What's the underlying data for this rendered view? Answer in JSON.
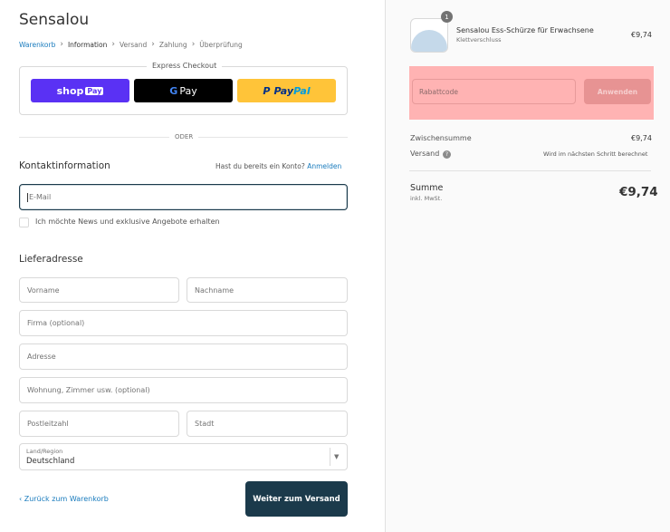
{
  "store": {
    "title": "Sensalou"
  },
  "breadcrumb": {
    "items": [
      "Warenkorb",
      "Information",
      "Versand",
      "Zahlung",
      "Überprüfung"
    ],
    "separator": "›"
  },
  "express_checkout": {
    "label": "Express Checkout",
    "buttons": {
      "shop_pay": {
        "text": "shop",
        "badge": "Pay"
      },
      "google_pay": {
        "g": "G",
        "text": "Pay"
      },
      "paypal": {
        "part1": "Pay",
        "part2": "Pal",
        "mark": "P"
      }
    },
    "divider": "ODER"
  },
  "contact": {
    "title": "Kontaktinformation",
    "account_prompt": "Hast du bereits ein Konto?",
    "login_link": "Anmelden",
    "email_placeholder": "E-Mail",
    "newsletter_label": "Ich möchte News und exklusive Angebote erhalten"
  },
  "shipping": {
    "title": "Lieferadresse",
    "first_name": "Vorname",
    "last_name": "Nachname",
    "company": "Firma (optional)",
    "address": "Adresse",
    "apartment": "Wohnung, Zimmer usw. (optional)",
    "postal_code": "Postleitzahl",
    "city": "Stadt",
    "country_label": "Land/Region",
    "country_value": "Deutschland"
  },
  "actions": {
    "back_link": "‹ Zurück zum Warenkorb",
    "continue_button": "Weiter zum Versand"
  },
  "order": {
    "quantity": "1",
    "product_name": "Sensalou Ess-Schürze für Erwachsene",
    "product_variant": "Klettverschluss",
    "product_price": "€9,74",
    "discount_placeholder": "Rabattcode",
    "apply_button": "Anwenden",
    "subtotal_label": "Zwischensumme",
    "subtotal_value": "€9,74",
    "shipping_label": "Versand",
    "shipping_note": "Wird im nächsten Schritt berechnet",
    "total_label": "Summe",
    "tax_note": "inkl. MwSt.",
    "total_value": "€9,74"
  },
  "colors": {
    "primary": "#1b3a4b",
    "link": "#197bbd",
    "highlight": "#ffb3b3",
    "shop_pay": "#5a31f4",
    "paypal": "#ffc439"
  }
}
